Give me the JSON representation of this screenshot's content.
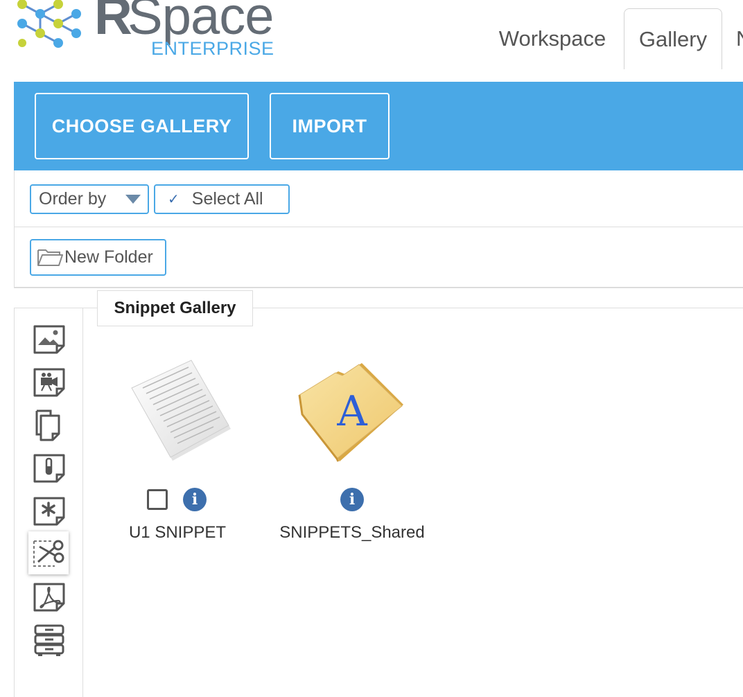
{
  "header": {
    "logo": {
      "brand_bold": "R",
      "brand_rest": "Space",
      "edition": "ENTERPRISE"
    },
    "tabs": [
      {
        "label": "Workspace",
        "active": false
      },
      {
        "label": "Gallery",
        "active": true
      },
      {
        "label": "N",
        "active": false
      }
    ]
  },
  "toolbar": {
    "choose_gallery_label": "CHOOSE GALLERY",
    "import_label": "IMPORT",
    "background_color": "#4aa8e6"
  },
  "filters": {
    "order_by_label": "Order by",
    "select_all_label": "Select All",
    "new_folder_label": "New Folder"
  },
  "sidebar": {
    "items": [
      {
        "icon": "image-icon",
        "active": false
      },
      {
        "icon": "video-icon",
        "active": false
      },
      {
        "icon": "documents-icon",
        "active": false
      },
      {
        "icon": "chemistry-icon",
        "active": false
      },
      {
        "icon": "misc-icon",
        "active": false
      },
      {
        "icon": "snippets-icon",
        "active": true
      },
      {
        "icon": "pdf-icon",
        "active": false
      },
      {
        "icon": "filestore-icon",
        "active": false
      }
    ]
  },
  "gallery": {
    "title": "Snippet Gallery",
    "items": [
      {
        "name": "U1 SNIPPET",
        "type": "snippet-document",
        "has_checkbox": true
      },
      {
        "name": "SNIPPETS_Shared",
        "type": "shared-folder",
        "folder_letter": "A",
        "has_checkbox": false
      }
    ]
  },
  "colors": {
    "accent": "#4aa8e6",
    "info": "#3d6fad",
    "folder": "#f3d487"
  }
}
